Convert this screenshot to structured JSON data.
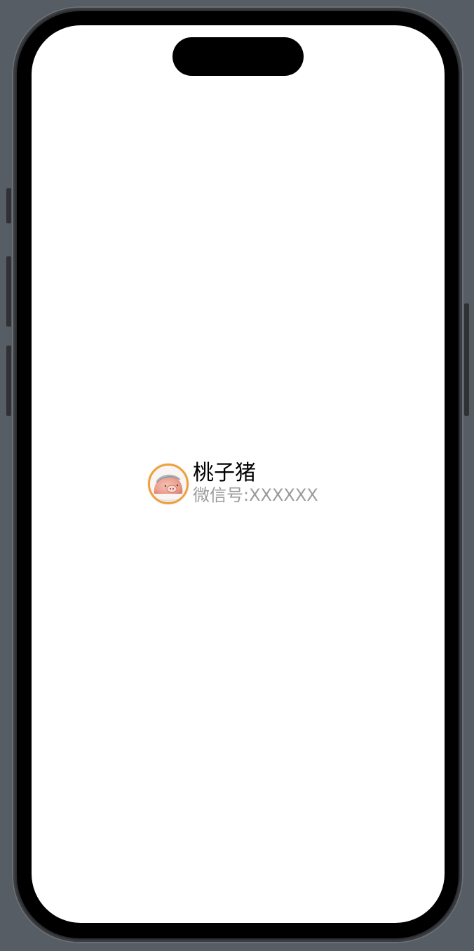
{
  "profile": {
    "name": "桃子猪",
    "wechat_id": "微信号:XXXXXX",
    "avatar_icon": "peach-pig-avatar"
  },
  "colors": {
    "avatar_border": "#eea037",
    "name_text": "#000000",
    "id_text": "#9b9b9b",
    "screen_background": "#ffffff",
    "device_background": "#575d64"
  }
}
